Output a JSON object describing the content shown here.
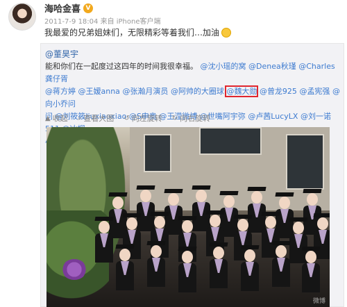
{
  "post": {
    "author": "海哈金喜",
    "verified_badge": "V",
    "meta": "2011-7-9 18:04 来自 iPhone客户端",
    "text": "我最爱的兄弟姐妹们，无限精彩等着我们…加油"
  },
  "repost": {
    "author": "@董昊宇",
    "intro": "能和你们在一起度过这四年的时间我很幸福。",
    "mentions_line1": [
      "@沈小瑶的窝",
      "@Denea秋瑾",
      "@Charles龚仔胥"
    ],
    "mentions_line2": [
      "@蒋方婷",
      "@王嫒anna",
      "@张瀚月演员",
      "@阿帅的大圈球",
      "@魏大勋",
      "@曾龙925",
      "@孟宪强",
      "@向小乔问"
    ],
    "mentions_line3": [
      "问",
      "@刘筱筱liuxiaoxiao",
      "@S申奥",
      "@王滢微博",
      "@世嘴阿宇弥",
      "@卢茜LucyLX",
      "@刘一诺511",
      "@冰榴"
    ],
    "mentions_line4": [
      "小恶魔",
      "@S蔡盛",
      "@演员明俊臣",
      "@海哈金喜"
    ],
    "highlighted_mention": "@魏大勋",
    "toolbar": {
      "collapse": "收起",
      "view_large": "查看大图",
      "rotate_left": "向左旋转",
      "rotate_right": "向右旋转"
    },
    "photo_watermark": "微博"
  },
  "colors": {
    "link": "#3d7bd0",
    "highlight_box": "#e0262e",
    "badge": "#f2a91e"
  }
}
